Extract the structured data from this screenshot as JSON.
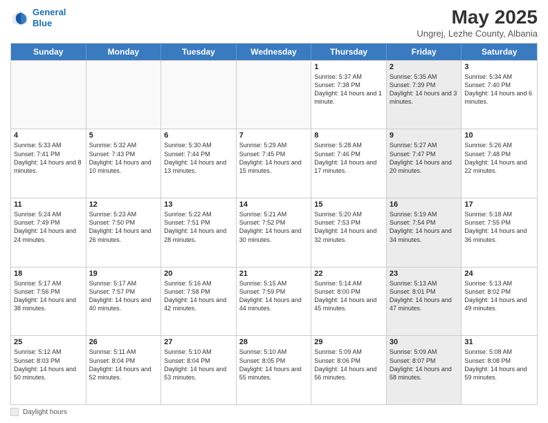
{
  "header": {
    "logo_line1": "General",
    "logo_line2": "Blue",
    "month_year": "May 2025",
    "location": "Ungrej, Lezhe County, Albania"
  },
  "days_of_week": [
    "Sunday",
    "Monday",
    "Tuesday",
    "Wednesday",
    "Thursday",
    "Friday",
    "Saturday"
  ],
  "weeks": [
    [
      {
        "day": "",
        "text": "",
        "shaded": false
      },
      {
        "day": "",
        "text": "",
        "shaded": false
      },
      {
        "day": "",
        "text": "",
        "shaded": false
      },
      {
        "day": "",
        "text": "",
        "shaded": false
      },
      {
        "day": "1",
        "text": "Sunrise: 5:37 AM\nSunset: 7:38 PM\nDaylight: 14 hours and 1 minute.",
        "shaded": false
      },
      {
        "day": "2",
        "text": "Sunrise: 5:35 AM\nSunset: 7:39 PM\nDaylight: 14 hours and 3 minutes.",
        "shaded": true
      },
      {
        "day": "3",
        "text": "Sunrise: 5:34 AM\nSunset: 7:40 PM\nDaylight: 14 hours and 6 minutes.",
        "shaded": false
      }
    ],
    [
      {
        "day": "4",
        "text": "Sunrise: 5:33 AM\nSunset: 7:41 PM\nDaylight: 14 hours and 8 minutes.",
        "shaded": false
      },
      {
        "day": "5",
        "text": "Sunrise: 5:32 AM\nSunset: 7:43 PM\nDaylight: 14 hours and 10 minutes.",
        "shaded": false
      },
      {
        "day": "6",
        "text": "Sunrise: 5:30 AM\nSunset: 7:44 PM\nDaylight: 14 hours and 13 minutes.",
        "shaded": false
      },
      {
        "day": "7",
        "text": "Sunrise: 5:29 AM\nSunset: 7:45 PM\nDaylight: 14 hours and 15 minutes.",
        "shaded": false
      },
      {
        "day": "8",
        "text": "Sunrise: 5:28 AM\nSunset: 7:46 PM\nDaylight: 14 hours and 17 minutes.",
        "shaded": false
      },
      {
        "day": "9",
        "text": "Sunrise: 5:27 AM\nSunset: 7:47 PM\nDaylight: 14 hours and 20 minutes.",
        "shaded": true
      },
      {
        "day": "10",
        "text": "Sunrise: 5:26 AM\nSunset: 7:48 PM\nDaylight: 14 hours and 22 minutes.",
        "shaded": false
      }
    ],
    [
      {
        "day": "11",
        "text": "Sunrise: 5:24 AM\nSunset: 7:49 PM\nDaylight: 14 hours and 24 minutes.",
        "shaded": false
      },
      {
        "day": "12",
        "text": "Sunrise: 5:23 AM\nSunset: 7:50 PM\nDaylight: 14 hours and 26 minutes.",
        "shaded": false
      },
      {
        "day": "13",
        "text": "Sunrise: 5:22 AM\nSunset: 7:51 PM\nDaylight: 14 hours and 28 minutes.",
        "shaded": false
      },
      {
        "day": "14",
        "text": "Sunrise: 5:21 AM\nSunset: 7:52 PM\nDaylight: 14 hours and 30 minutes.",
        "shaded": false
      },
      {
        "day": "15",
        "text": "Sunrise: 5:20 AM\nSunset: 7:53 PM\nDaylight: 14 hours and 32 minutes.",
        "shaded": false
      },
      {
        "day": "16",
        "text": "Sunrise: 5:19 AM\nSunset: 7:54 PM\nDaylight: 14 hours and 34 minutes.",
        "shaded": true
      },
      {
        "day": "17",
        "text": "Sunrise: 5:18 AM\nSunset: 7:55 PM\nDaylight: 14 hours and 36 minutes.",
        "shaded": false
      }
    ],
    [
      {
        "day": "18",
        "text": "Sunrise: 5:17 AM\nSunset: 7:56 PM\nDaylight: 14 hours and 38 minutes.",
        "shaded": false
      },
      {
        "day": "19",
        "text": "Sunrise: 5:17 AM\nSunset: 7:57 PM\nDaylight: 14 hours and 40 minutes.",
        "shaded": false
      },
      {
        "day": "20",
        "text": "Sunrise: 5:16 AM\nSunset: 7:58 PM\nDaylight: 14 hours and 42 minutes.",
        "shaded": false
      },
      {
        "day": "21",
        "text": "Sunrise: 5:15 AM\nSunset: 7:59 PM\nDaylight: 14 hours and 44 minutes.",
        "shaded": false
      },
      {
        "day": "22",
        "text": "Sunrise: 5:14 AM\nSunset: 8:00 PM\nDaylight: 14 hours and 45 minutes.",
        "shaded": false
      },
      {
        "day": "23",
        "text": "Sunrise: 5:13 AM\nSunset: 8:01 PM\nDaylight: 14 hours and 47 minutes.",
        "shaded": true
      },
      {
        "day": "24",
        "text": "Sunrise: 5:13 AM\nSunset: 8:02 PM\nDaylight: 14 hours and 49 minutes.",
        "shaded": false
      }
    ],
    [
      {
        "day": "25",
        "text": "Sunrise: 5:12 AM\nSunset: 8:03 PM\nDaylight: 14 hours and 50 minutes.",
        "shaded": false
      },
      {
        "day": "26",
        "text": "Sunrise: 5:11 AM\nSunset: 8:04 PM\nDaylight: 14 hours and 52 minutes.",
        "shaded": false
      },
      {
        "day": "27",
        "text": "Sunrise: 5:10 AM\nSunset: 8:04 PM\nDaylight: 14 hours and 53 minutes.",
        "shaded": false
      },
      {
        "day": "28",
        "text": "Sunrise: 5:10 AM\nSunset: 8:05 PM\nDaylight: 14 hours and 55 minutes.",
        "shaded": false
      },
      {
        "day": "29",
        "text": "Sunrise: 5:09 AM\nSunset: 8:06 PM\nDaylight: 14 hours and 56 minutes.",
        "shaded": false
      },
      {
        "day": "30",
        "text": "Sunrise: 5:09 AM\nSunset: 8:07 PM\nDaylight: 14 hours and 58 minutes.",
        "shaded": true
      },
      {
        "day": "31",
        "text": "Sunrise: 5:08 AM\nSunset: 8:08 PM\nDaylight: 14 hours and 59 minutes.",
        "shaded": false
      }
    ]
  ],
  "footer": {
    "legend_label": "Daylight hours"
  }
}
